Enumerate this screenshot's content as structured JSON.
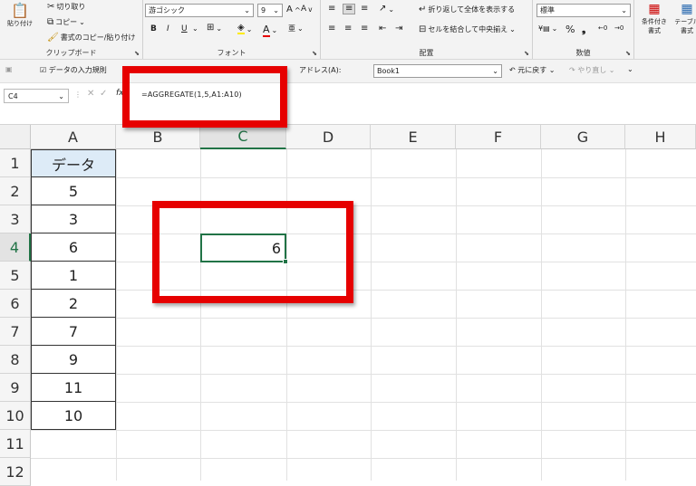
{
  "ribbon": {
    "clipboard": {
      "paste": "貼り付け",
      "cut": "切り取り",
      "copy": "コピー",
      "format_painter": "書式のコピー/貼り付け",
      "label": "クリップボード"
    },
    "font": {
      "name": "游ゴシック",
      "size": "9",
      "bold": "B",
      "italic": "I",
      "underline": "U",
      "color_a": "A",
      "label": "フォント"
    },
    "alignment": {
      "wrap": "折り返して全体を表示する",
      "merge": "セルを結合して中央揃え",
      "label": "配置"
    },
    "number": {
      "format": "標準",
      "label": "数値"
    },
    "styles": {
      "conditional": "条件付き書式",
      "table": "テーブル書式"
    }
  },
  "qat": {
    "items": [
      "データの入力規則",
      "アドレス(A):",
      "Book1",
      "元に戻す",
      "やり直し"
    ]
  },
  "formula_bar": {
    "name_box": "C4",
    "formula": "=AGGREGATE(1,5,A1:A10)",
    "fx": "fx"
  },
  "columns": [
    "A",
    "B",
    "C",
    "D",
    "E",
    "F",
    "G",
    "H"
  ],
  "rows": [
    "1",
    "2",
    "3",
    "4",
    "5",
    "6",
    "7",
    "8",
    "9",
    "10",
    "11",
    "12"
  ],
  "column_a": [
    "データ",
    "5",
    "3",
    "6",
    "1",
    "2",
    "7",
    "9",
    "11",
    "10"
  ],
  "active_cell": {
    "address": "C4",
    "value": "6"
  },
  "colors": {
    "accent": "#217346",
    "header_fill": "#ddebf7",
    "highlight": "#e60000"
  }
}
